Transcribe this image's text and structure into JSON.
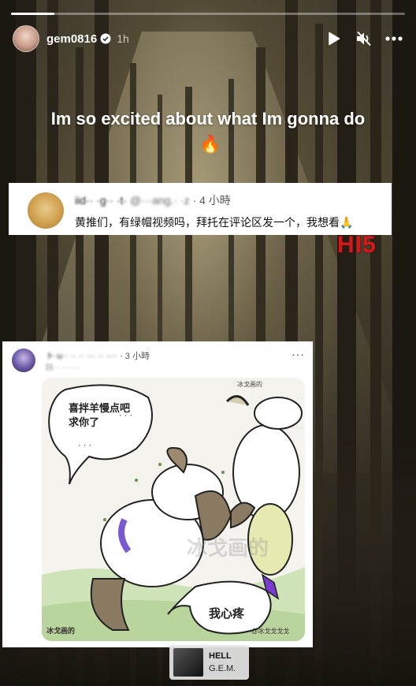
{
  "story": {
    "progress": 0.11,
    "username": "gem0816",
    "time": "1h",
    "caption": "Im so excited about what Im gonna do",
    "caption_emoji": "🔥",
    "sticker_text": "HI5"
  },
  "header_icons": {
    "avatar": "user-avatar",
    "verified": "verified-badge-icon",
    "play": "play-icon",
    "mute": "mute-icon",
    "more": "more-icon"
  },
  "tweet1": {
    "name": "iid·· ·g·· ·t·",
    "handle": "@···ang.· ·z",
    "separator": "·",
    "time": "4 小時",
    "text": "黄推们，有绿帽视频吗，拜托在评论区发一个，我想看🙏"
  },
  "tweet2": {
    "name": "ト·u·· ·· ·· ··· ·· ····",
    "time": "· 3 小時",
    "subline": "回··· ···· ···",
    "more": "···",
    "comic": {
      "bubble1_line1": "喜拌羊慢点吧",
      "bubble1_line2": "求你了",
      "bubble1_dots": "· · ·",
      "bubble1_dots2": "· · ·",
      "bubble2": "我心疼",
      "watermark": "冰戈画的",
      "signature_top": "冰戈画的",
      "signature_bottom": "冰戈画的",
      "credit": "@冰戈戈戈戈"
    }
  },
  "music": {
    "title": "HELL",
    "artist": "G.E.M."
  }
}
